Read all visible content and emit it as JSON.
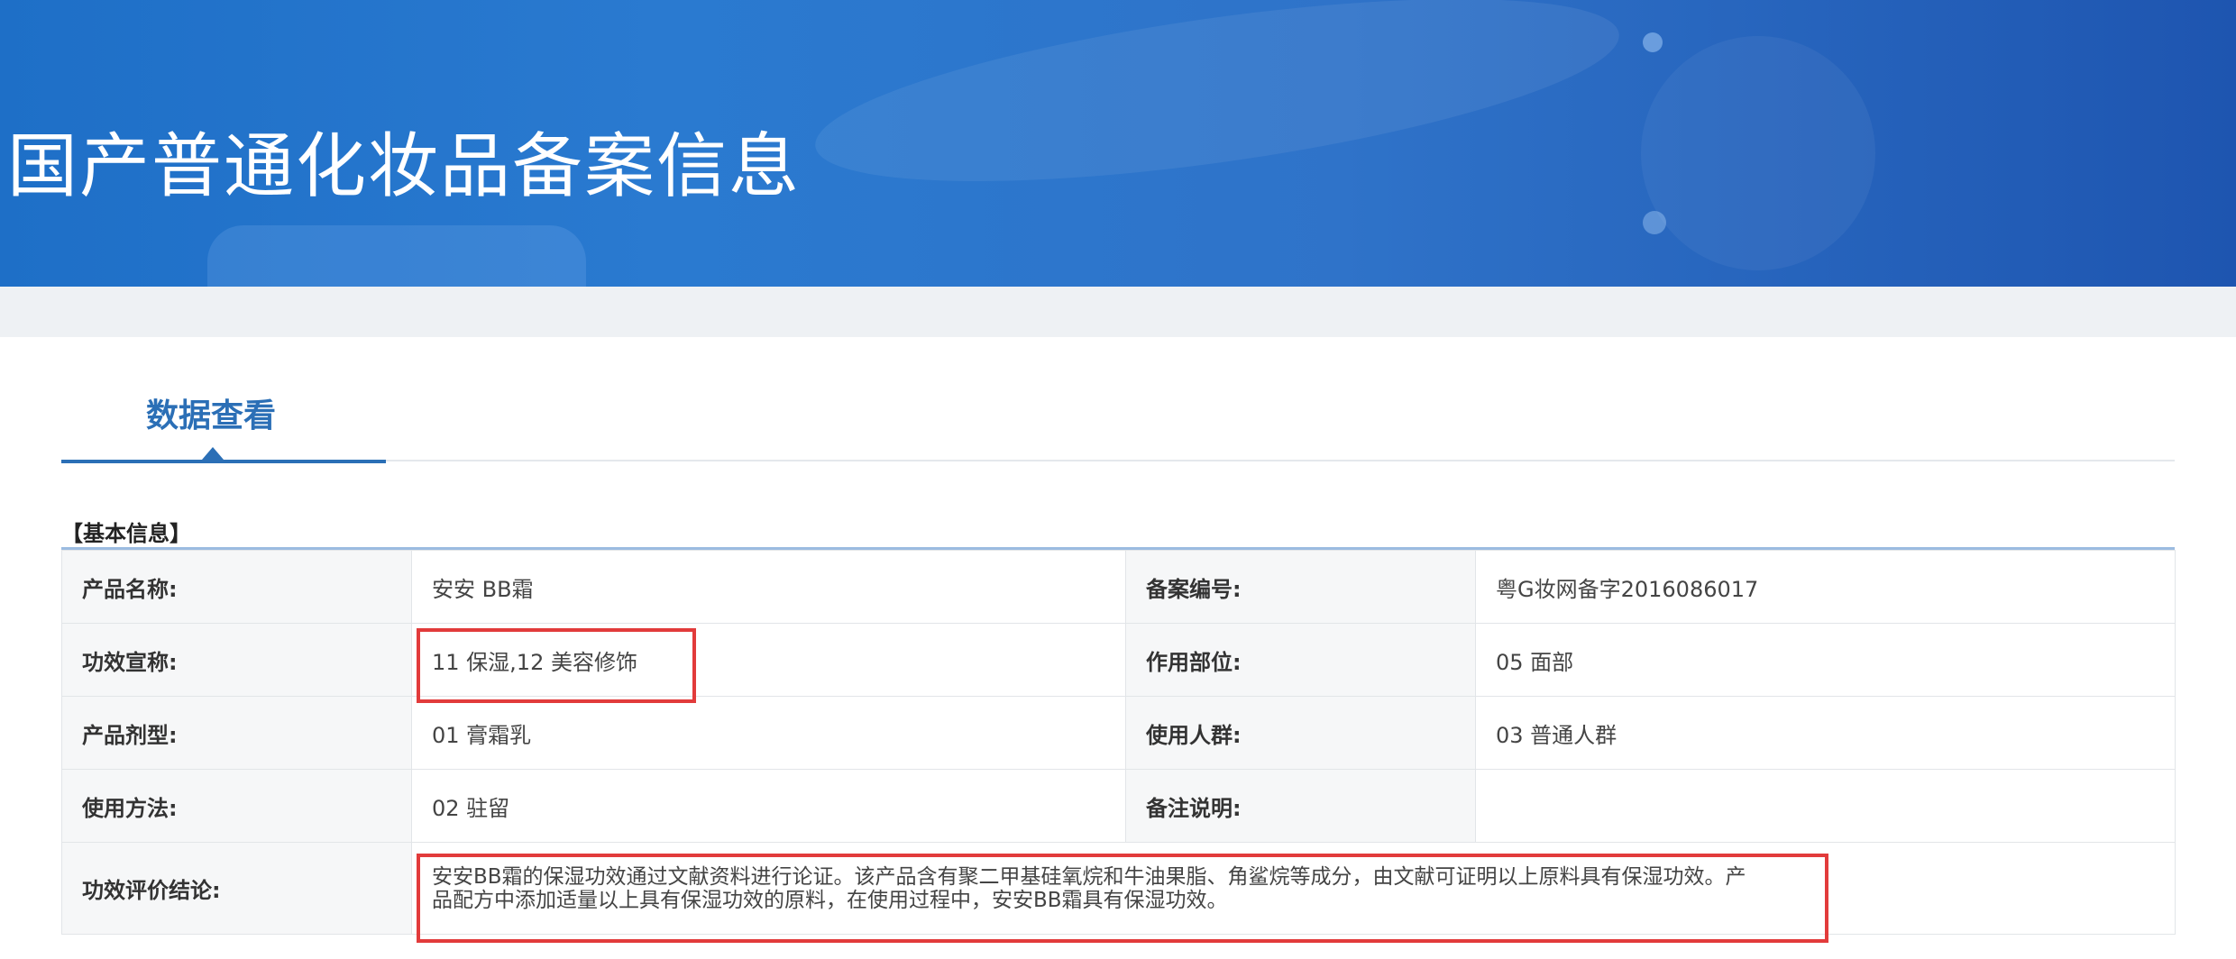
{
  "banner": {
    "title": "国产普通化妆品备案信息"
  },
  "tabs": [
    {
      "label": "数据查看",
      "active": true
    }
  ],
  "section": {
    "title": "【基本信息】"
  },
  "info": {
    "product_name_label": "产品名称:",
    "product_name": "安安 BB霜",
    "record_no_label": "备案编号:",
    "record_no": "粤G妆网备字2016086017",
    "claim_label": "功效宣称:",
    "claim": "11 保湿,12 美容修饰",
    "site_label": "作用部位:",
    "site": "05 面部",
    "form_label": "产品剂型:",
    "form": "01 膏霜乳",
    "users_label": "使用人群:",
    "users": "03 普通人群",
    "usage_label": "使用方法:",
    "usage": "02 驻留",
    "remark_label": "备注说明:",
    "remark": "",
    "conclusion_label": "功效评价结论:",
    "conclusion": "安安BB霜的保湿功效通过文献资料进行论证。该产品含有聚二甲基硅氧烷和牛油果脂、角鲨烷等成分，由文献可证明以上原料具有保湿功效。产品配方中添加适量以上具有保湿功效的原料，在使用过程中，安安BB霜具有保湿功效。"
  },
  "colors": {
    "banner": "#2a7ad0",
    "accent": "#2b6fb6",
    "highlight": "#e23b3b"
  }
}
